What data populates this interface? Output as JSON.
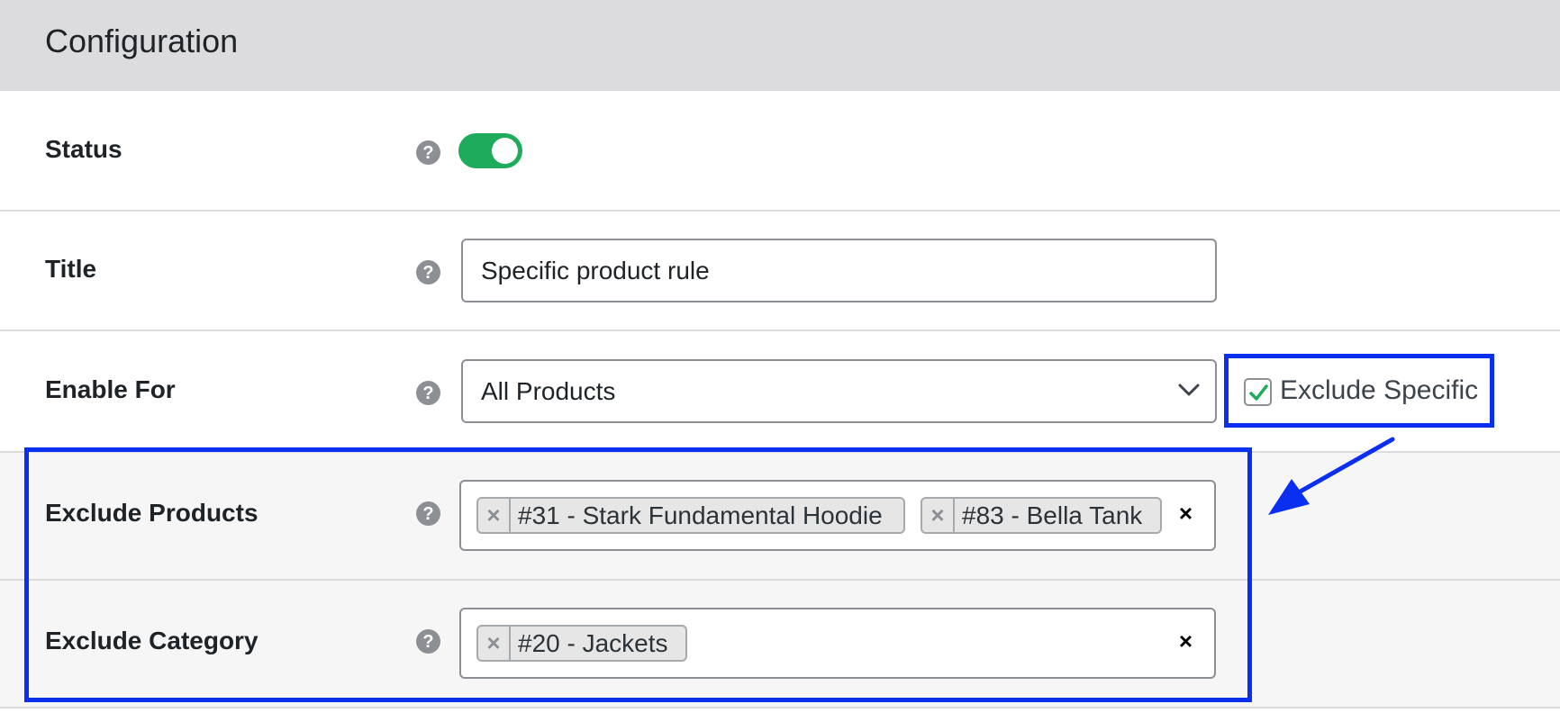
{
  "header": {
    "title": "Configuration"
  },
  "rows": {
    "status": {
      "label": "Status",
      "help_icon": "question-mark-icon",
      "toggle_on": true
    },
    "title": {
      "label": "Title",
      "help_icon": "question-mark-icon",
      "value": "Specific product rule"
    },
    "enable_for": {
      "label": "Enable For",
      "help_icon": "question-mark-icon",
      "selected": "All Products",
      "exclude_specific_label": "Exclude Specific",
      "exclude_specific_checked": true
    },
    "exclude_products": {
      "label": "Exclude Products",
      "help_icon": "question-mark-icon",
      "tags": [
        "#31 - Stark Fundamental Hoodie",
        "#83 - Bella Tank"
      ]
    },
    "exclude_category": {
      "label": "Exclude Category",
      "help_icon": "question-mark-icon",
      "tags": [
        "#20 - Jackets"
      ]
    }
  },
  "glyphs": {
    "help": "?",
    "tag_remove": "×",
    "clear": "×"
  },
  "colors": {
    "toggle_on": "#1eab5b",
    "highlight": "#0a2ff0",
    "checkmark": "#1eab5b"
  }
}
